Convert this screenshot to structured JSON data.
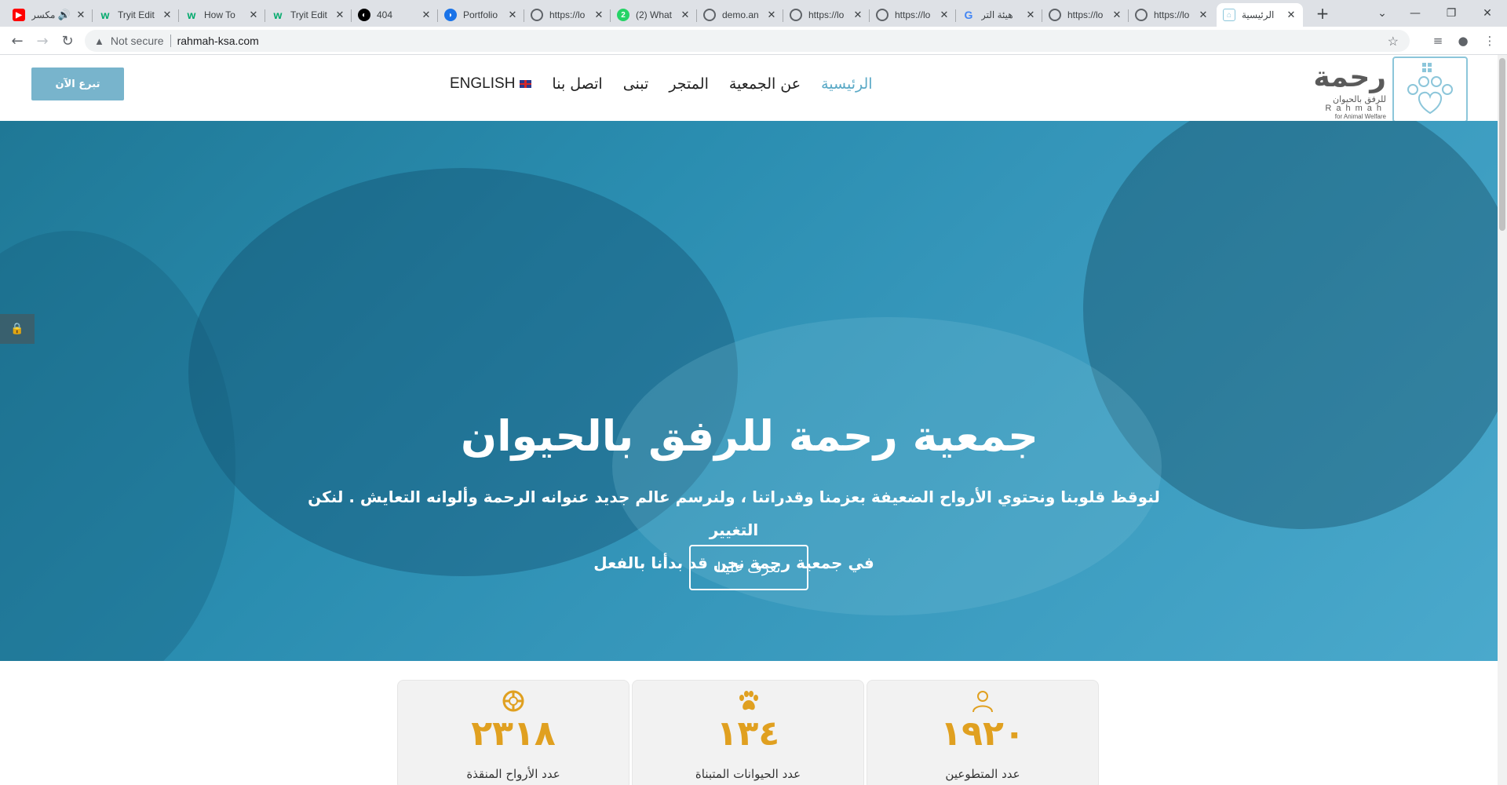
{
  "browser": {
    "tabs": [
      {
        "title": "مكسر",
        "fav_color": "#ff0000",
        "fav": "▶",
        "audio": "🔊"
      },
      {
        "title": "Tryit Edit",
        "fav_color": "#04aa6d",
        "fav": "w"
      },
      {
        "title": "How To",
        "fav_color": "#04aa6d",
        "fav": "w"
      },
      {
        "title": "Tryit Edit",
        "fav_color": "#04aa6d",
        "fav": "w"
      },
      {
        "title": "404",
        "fav_color": "#000000",
        "fav": "◐"
      },
      {
        "title": "Portfolio",
        "fav_color": "#1a73e8",
        "fav": "◗"
      },
      {
        "title": "https://lo",
        "fav_color": "#5f6368",
        "fav": "◎"
      },
      {
        "title": "(2) What",
        "fav_color": "#25d366",
        "fav": "2"
      },
      {
        "title": "demo.an",
        "fav_color": "#5f6368",
        "fav": "◎"
      },
      {
        "title": "https://lo",
        "fav_color": "#5f6368",
        "fav": "◎"
      },
      {
        "title": "https://lo",
        "fav_color": "#5f6368",
        "fav": "◎"
      },
      {
        "title": "هيئة التر",
        "fav_color": "#4285f4",
        "fav": "G"
      },
      {
        "title": "https://lo",
        "fav_color": "#5f6368",
        "fav": "◎"
      },
      {
        "title": "https://lo",
        "fav_color": "#5f6368",
        "fav": "◎"
      },
      {
        "title": "الرئيسية",
        "fav_color": "#8cc6da",
        "fav": "⌂",
        "active": true
      }
    ],
    "security_label": "Not secure",
    "url": "rahmah-ksa.com"
  },
  "header": {
    "donate_label": "تبرع الآن",
    "nav": [
      {
        "label": "الرئيسية",
        "active": true
      },
      {
        "label": "عن الجمعية"
      },
      {
        "label": "المتجر"
      },
      {
        "label": "تبنى"
      },
      {
        "label": "اتصل بنا"
      }
    ],
    "lang_label": "ENGLISH",
    "logo": {
      "name_ar": "رحمة",
      "sub_ar": "للرفق بالحيوان",
      "name_en": "Rahmah",
      "sub_en": "for Animal Welfare"
    }
  },
  "hero": {
    "title": "جمعية رحمة للرفق بالحيوان",
    "subtitle_line1": "لنوقظ قلوبنا ونحتوي الأرواح الضعيفة بعزمنا وقدراتنا ، ولنرسم عالم جديد عنوانه الرحمة وألوانه التعايش . لنكن التغيير",
    "subtitle_line2": "في جمعية رحمة نحن قد بدأنا بالفعل",
    "button_label": "تعرف علينا"
  },
  "stats": [
    {
      "value": "٢٣١٨",
      "label": "عدد الأرواح المنقذة",
      "icon": "lifebuoy-icon"
    },
    {
      "value": "١٣٤",
      "label": "عدد الحيوانات المتبناة",
      "icon": "paw-icon"
    },
    {
      "value": "١٩٢٠",
      "label": "عدد المتطوعين",
      "icon": "user-icon"
    }
  ],
  "colors": {
    "accent": "#5aa9c6",
    "stat": "#e0a020",
    "donate": "#78b4cc"
  }
}
